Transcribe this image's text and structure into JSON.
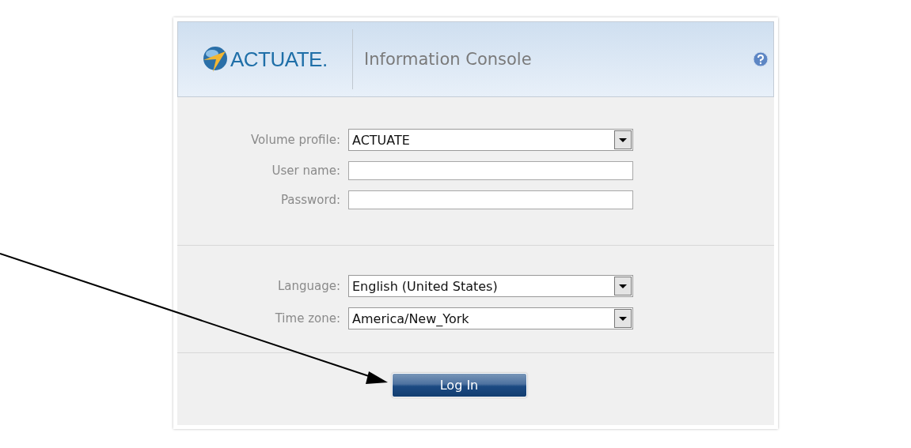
{
  "header": {
    "logo": "ACTUATE.",
    "title": "Information Console"
  },
  "login_fields": [
    {
      "kind": "select",
      "label": "Volume profile:",
      "value": "ACTUATE"
    },
    {
      "kind": "text",
      "label": "User name:"
    },
    {
      "kind": "text",
      "label": "Password:"
    }
  ],
  "locale_fields": [
    {
      "kind": "select",
      "label": "Language:",
      "value": "English (United States)"
    },
    {
      "kind": "select",
      "label": "Time zone:",
      "value": "America/New_York"
    }
  ],
  "login_button": "Log In"
}
